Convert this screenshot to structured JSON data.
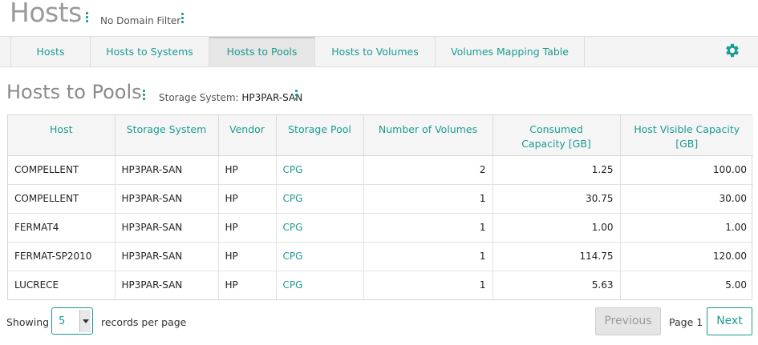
{
  "header": {
    "title": "Hosts",
    "domain_filter": "No Domain Filter"
  },
  "tabs": [
    {
      "label": "Hosts",
      "active": false
    },
    {
      "label": "Hosts to Systems",
      "active": false
    },
    {
      "label": "Hosts to Pools",
      "active": true
    },
    {
      "label": "Hosts to Volumes",
      "active": false
    },
    {
      "label": "Volumes Mapping Table",
      "active": false
    }
  ],
  "section": {
    "title": "Hosts to Pools",
    "storage_label": "Storage System:",
    "storage_value": "HP3PAR-SAN"
  },
  "table": {
    "columns": [
      "Host",
      "Storage System",
      "Vendor",
      "Storage Pool",
      "Number of Volumes",
      "Consumed Capacity [GB]",
      "Host Visible Capacity [GB]"
    ],
    "rows": [
      [
        "COMPELLENT",
        "HP3PAR-SAN",
        "HP",
        "CPG",
        "2",
        "1.25",
        "100.00"
      ],
      [
        "COMPELLENT",
        "HP3PAR-SAN",
        "HP",
        "CPG",
        "1",
        "30.75",
        "30.00"
      ],
      [
        "FERMAT4",
        "HP3PAR-SAN",
        "HP",
        "CPG",
        "1",
        "1.00",
        "1.00"
      ],
      [
        "FERMAT-SP2010",
        "HP3PAR-SAN",
        "HP",
        "CPG",
        "1",
        "114.75",
        "120.00"
      ],
      [
        "LUCRECE",
        "HP3PAR-SAN",
        "HP",
        "CPG",
        "1",
        "5.63",
        "5.00"
      ]
    ]
  },
  "footer": {
    "showing_label": "Showing",
    "page_size": "5",
    "per_page_label": "records per page",
    "previous_label": "Previous",
    "page_label": "Page 1",
    "next_label": "Next"
  },
  "colors": {
    "accent": "#1a9c93",
    "title_gray": "#9a9a9a"
  },
  "icons": {
    "settings": "gear-icon",
    "menu": "kebab-menu-icon",
    "dropdown": "chevron-down-icon"
  }
}
